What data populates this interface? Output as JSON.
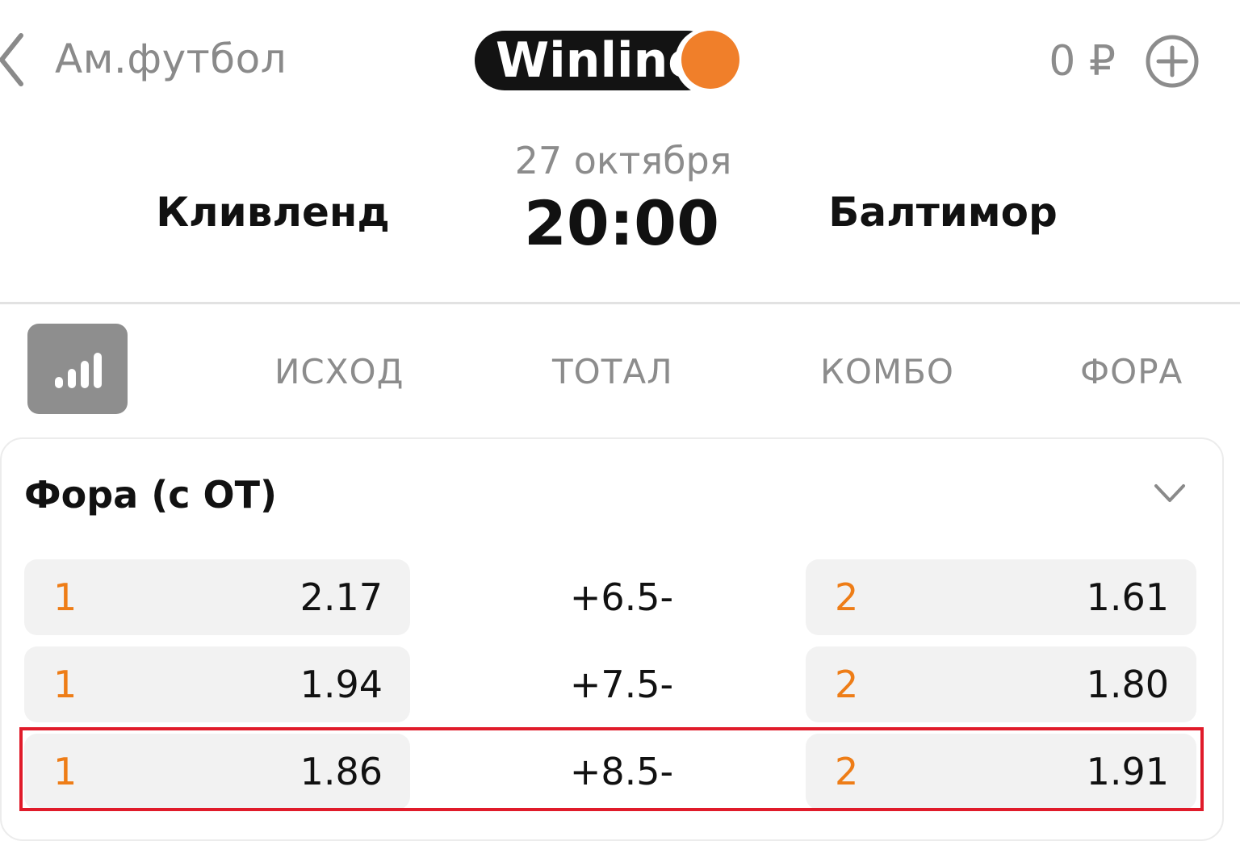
{
  "header": {
    "back_icon": "chevron-left-icon",
    "section": "Ам.футбол",
    "logo_text": "Winline",
    "balance": "0 ₽",
    "add_icon": "plus-circle-icon",
    "brand_color": "#f07f2a"
  },
  "match": {
    "date": "27 октября",
    "time": "20:00",
    "home_team": "Кливленд",
    "away_team": "Балтимор"
  },
  "tabs": {
    "stats_icon": "signal-bars-icon",
    "items": [
      {
        "label": "ИСХОД"
      },
      {
        "label": "ТОТАЛ"
      },
      {
        "label": "КОМБО"
      },
      {
        "label": "ФОРА"
      }
    ]
  },
  "market": {
    "title": "Фора (с ОТ)",
    "collapse_icon": "chevron-down-icon",
    "rows": [
      {
        "left_outcome": "1",
        "left_coef": "2.17",
        "handicap": "+6.5-",
        "right_outcome": "2",
        "right_coef": "1.61"
      },
      {
        "left_outcome": "1",
        "left_coef": "1.94",
        "handicap": "+7.5-",
        "right_outcome": "2",
        "right_coef": "1.80"
      },
      {
        "left_outcome": "1",
        "left_coef": "1.86",
        "handicap": "+8.5-",
        "right_outcome": "2",
        "right_coef": "1.91"
      }
    ],
    "highlight_color": "#e01b2a",
    "outcome_color": "#ee7d17"
  }
}
